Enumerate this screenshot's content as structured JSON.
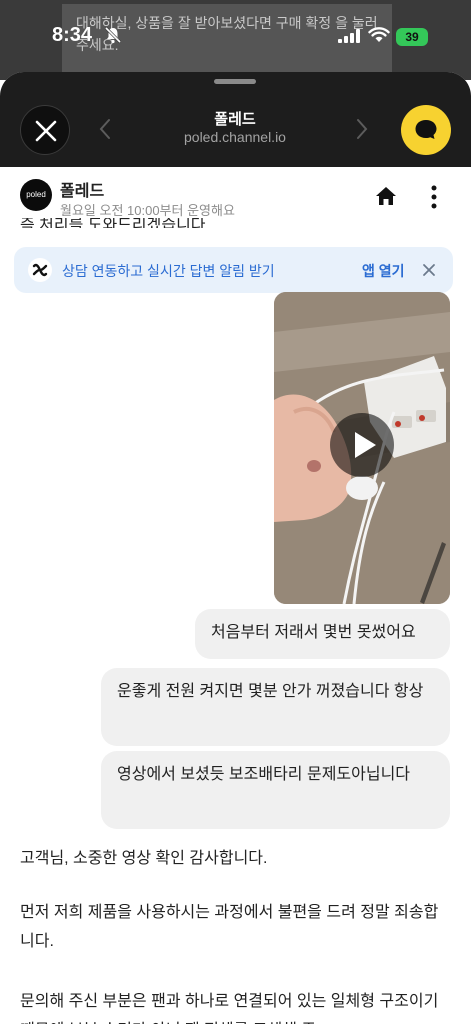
{
  "status_bar": {
    "time": "8:34",
    "battery": "39"
  },
  "backdrop": {
    "text": "대해하실, 상품을 잘 받아보셨다면 구매 확정 을 눌러 주세요."
  },
  "browser": {
    "title": "폴레드",
    "url": "poled.channel.io"
  },
  "channel": {
    "avatar_text": "poled",
    "name": "폴레드",
    "hours": "월요일 오전 10:00부터 운영해요"
  },
  "cut_off_text": "즉 처리를 도와드리겠습니다.",
  "banner": {
    "text": "상담 연동하고 실시간 답변 알림 받기",
    "action": "앱 열기"
  },
  "messages": {
    "m1": "처음부터 저래서 몇번 못썼어요",
    "m2": "운좋게 전원 켜지면 몇분 안가 꺼졌습니다 항상",
    "m3": "영상에서 보셨듯 보조배타리 문제도아닙니다"
  },
  "reply": {
    "p1": "고객님, 소중한 영상 확인 감사합니다.",
    "p2": "먼저 저희 제품을 사용하시는 과정에서 불편을 드려 정말 죄송합니다.",
    "p3": "문의해 주신 부분은 팬과 하나로 연결되어 있는 일체형 구조이기 때문에 부분 수리가 아닌 팬 전체를 교체해 주"
  },
  "colors": {
    "accent": "#f7d230",
    "link": "#2b6cd2",
    "bubble": "#f0f0f0"
  }
}
